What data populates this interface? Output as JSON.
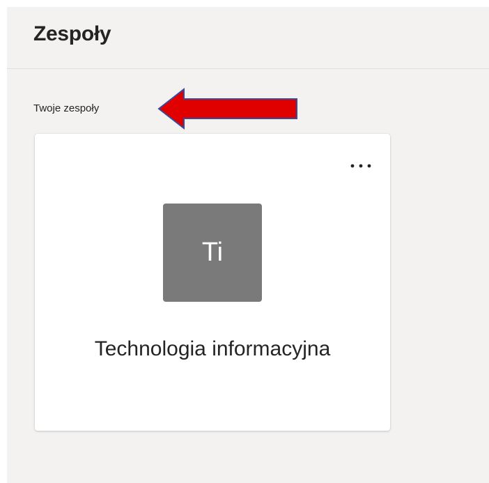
{
  "header": {
    "title": "Zespoły"
  },
  "section": {
    "label": "Twoje zespoły"
  },
  "team_card": {
    "avatar_initials": "Ti",
    "name": "Technologia informacyjna",
    "more_icon": "more-horizontal-icon"
  },
  "annotation": {
    "arrow_color": "#e00000",
    "arrow_outline": "#3a4a9a"
  },
  "colors": {
    "panel_background": "#f3f2f1",
    "avatar_background": "#7a7a7a"
  }
}
